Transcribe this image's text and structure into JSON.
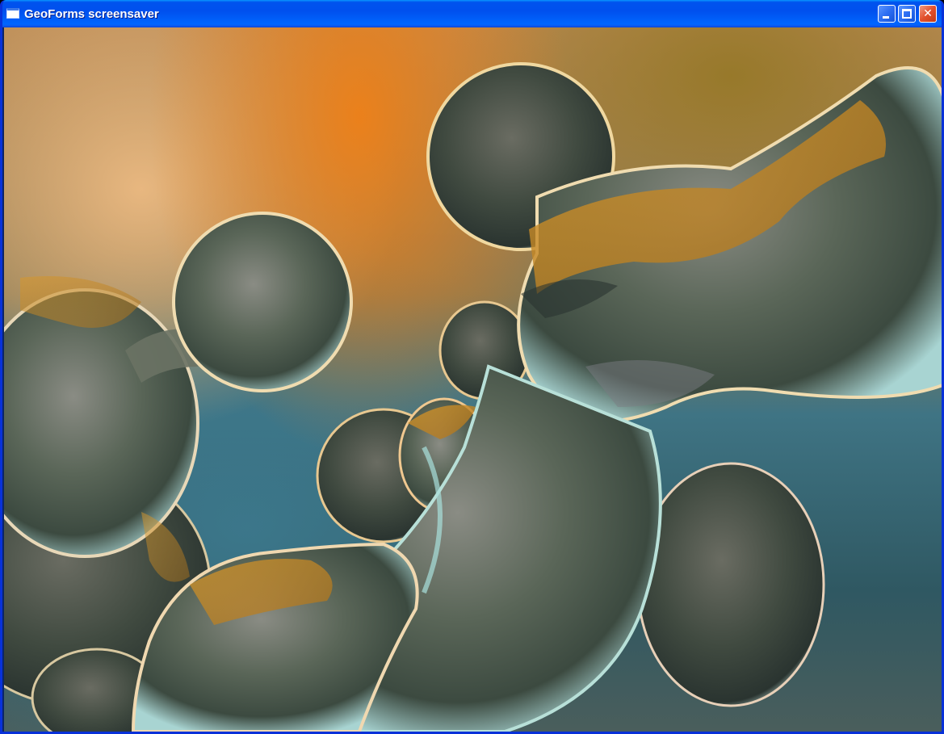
{
  "window": {
    "title": "GeoForms screensaver",
    "icon": "window-icon"
  },
  "controls": {
    "minimize_icon": "minimize-icon",
    "maximize_icon": "maximize-icon",
    "close_icon": "close-icon",
    "close_glyph": "✕"
  },
  "colors": {
    "titlebar": "#0055e5",
    "close_button": "#e2502c",
    "accent_orange": "#ee8018",
    "teal_background": "#3c788c"
  }
}
